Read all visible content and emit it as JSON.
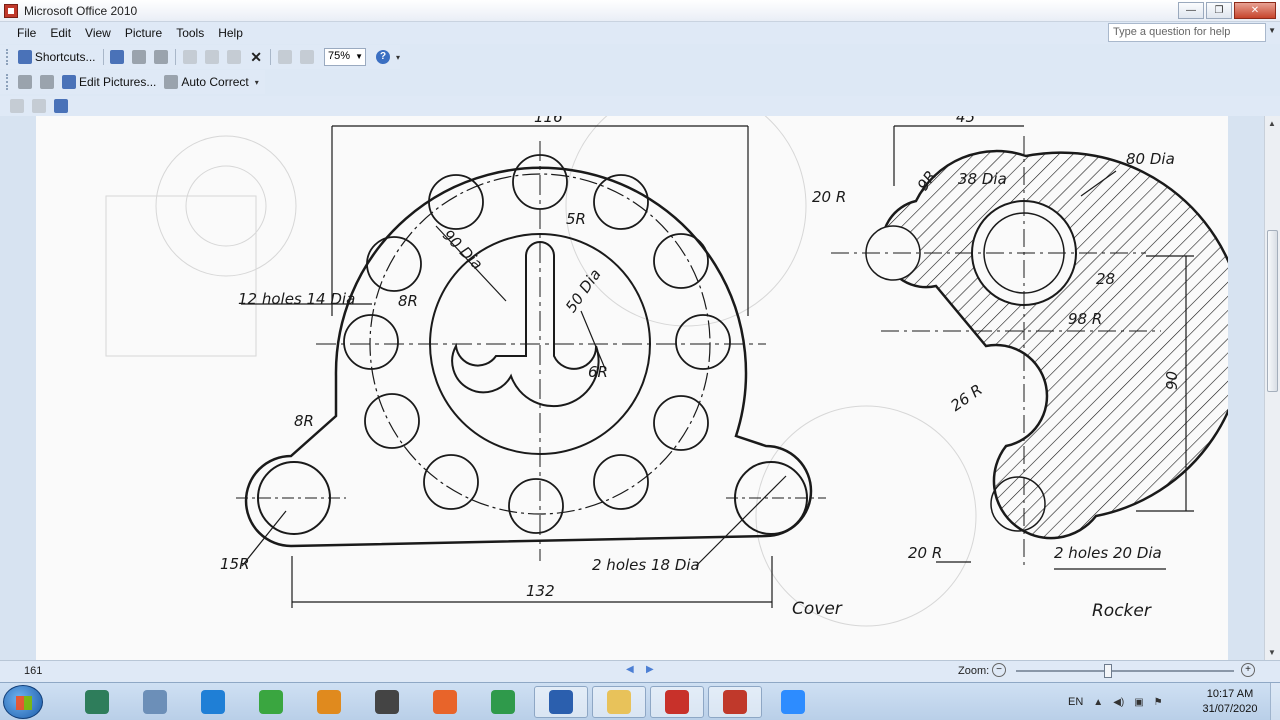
{
  "window": {
    "title": "Microsoft Office 2010",
    "minimize": "—",
    "maximize": "❐",
    "close": "✕"
  },
  "menu": [
    "File",
    "Edit",
    "View",
    "Picture",
    "Tools",
    "Help"
  ],
  "help_search": {
    "placeholder": "Type a question for help"
  },
  "toolbar": {
    "shortcuts_label": "Shortcuts...",
    "zoom_value": "75%",
    "edit_pictures_label": "Edit Pictures...",
    "auto_correct_label": "Auto Correct"
  },
  "drawing": {
    "dimensions": {
      "top_width_left": "116",
      "top_width_right": "45",
      "base_width": "132",
      "height": "90"
    },
    "labels": {
      "holes_12": "12 holes 14 Dia",
      "dia_90": "90 Dia",
      "r5": "5R",
      "dia_50": "50 Dia",
      "r8_inner": "8R",
      "r6": "6R",
      "r8_outer": "8R",
      "r15": "15R",
      "holes_18": "2 holes 18 Dia",
      "r9": "9R",
      "dia_80": "80 Dia",
      "dia_38": "38 Dia",
      "r20_top": "20 R",
      "r28": "28",
      "r98": "98 R",
      "r26": "26 R",
      "r20_bottom": "20 R",
      "holes_20": "2 holes 20 Dia"
    },
    "captions": {
      "cover": "Cover",
      "rocker": "Rocker"
    }
  },
  "status": {
    "page_number": "161",
    "zoom_label": "Zoom:",
    "zoom_out": "−",
    "zoom_in": "+",
    "zoom_fraction": 0.42
  },
  "taskbar": {
    "apps": [
      {
        "name": "file-manager-icon",
        "color": "#2e7d5b"
      },
      {
        "name": "calculator-icon",
        "color": "#6c8fb8"
      },
      {
        "name": "internet-explorer-icon",
        "color": "#1f7fd6"
      },
      {
        "name": "marker-icon",
        "color": "#3aa640"
      },
      {
        "name": "media-player-icon",
        "color": "#e08a1e"
      },
      {
        "name": "scanner-icon",
        "color": "#444444"
      },
      {
        "name": "firefox-icon",
        "color": "#e8642a"
      },
      {
        "name": "chrome-icon",
        "color": "#2f9a4b"
      },
      {
        "name": "word-icon",
        "color": "#2b5fae"
      },
      {
        "name": "folder-icon",
        "color": "#e8c25a"
      },
      {
        "name": "acrobat-icon",
        "color": "#c8312a"
      },
      {
        "name": "office-picture-icon",
        "color": "#c0392b"
      },
      {
        "name": "zoom-icon",
        "color": "#2d8cff"
      }
    ],
    "language": "EN",
    "time": "10:17 AM",
    "date": "31/07/2020"
  }
}
